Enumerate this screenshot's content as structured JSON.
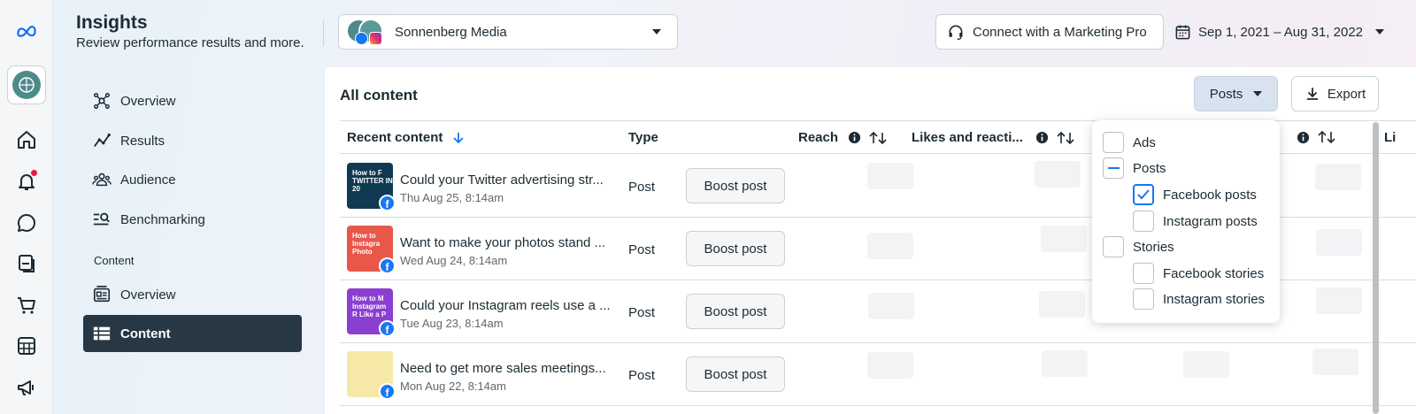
{
  "header": {
    "title": "Insights",
    "subtitle": "Review performance results and more.",
    "account_name": "Sonnenberg Media",
    "marketing_pro_label": "Connect with a Marketing Pro",
    "date_range": "Sep 1, 2021 – Aug 31, 2022"
  },
  "sidebar": {
    "items": [
      {
        "label": "Overview",
        "icon": "overview-icon"
      },
      {
        "label": "Results",
        "icon": "results-icon"
      },
      {
        "label": "Audience",
        "icon": "audience-icon"
      },
      {
        "label": "Benchmarking",
        "icon": "benchmarking-icon"
      }
    ],
    "section_label": "Content",
    "content_items": [
      {
        "label": "Overview",
        "icon": "content-overview-icon"
      },
      {
        "label": "Content",
        "icon": "table-icon",
        "active": true
      }
    ]
  },
  "rail_icons": [
    "meta-logo",
    "home-icon",
    "bell-icon",
    "chat-icon",
    "pages-icon",
    "cart-icon",
    "calculator-icon",
    "megaphone-icon"
  ],
  "panel": {
    "title": "All content",
    "filter_label": "Posts",
    "export_label": "Export",
    "columns": [
      "Recent content",
      "Type",
      "Reach",
      "Likes and reacti...",
      "Li"
    ],
    "rows": [
      {
        "title": "Could your Twitter advertising str...",
        "date": "Thu Aug 25, 8:14am",
        "type": "Post",
        "action": "Boost post",
        "thumb_text": "How to F TWITTER IN 20"
      },
      {
        "title": "Want to make your photos stand ...",
        "date": "Wed Aug 24, 8:14am",
        "type": "Post",
        "action": "Boost post",
        "thumb_text": "How to Instagra Photo"
      },
      {
        "title": "Could your Instagram reels use a ...",
        "date": "Tue Aug 23, 8:14am",
        "type": "Post",
        "action": "Boost post",
        "thumb_text": "How to M Instagram R Like a P"
      },
      {
        "title": "Need to get more sales meetings...",
        "date": "Mon Aug 22, 8:14am",
        "type": "Post",
        "action": "Boost post",
        "thumb_text": ""
      }
    ]
  },
  "filter_menu": {
    "options": [
      {
        "label": "Ads",
        "state": "unchecked",
        "level": 0
      },
      {
        "label": "Posts",
        "state": "indeterminate",
        "level": 0
      },
      {
        "label": "Facebook posts",
        "state": "checked",
        "level": 1
      },
      {
        "label": "Instagram posts",
        "state": "unchecked",
        "level": 1
      },
      {
        "label": "Stories",
        "state": "unchecked",
        "level": 0
      },
      {
        "label": "Facebook stories",
        "state": "unchecked",
        "level": 1
      },
      {
        "label": "Instagram stories",
        "state": "unchecked",
        "level": 1
      }
    ]
  },
  "colors": {
    "accent": "#1877f2",
    "active_nav": "#283744",
    "text": "#1c2b33"
  }
}
